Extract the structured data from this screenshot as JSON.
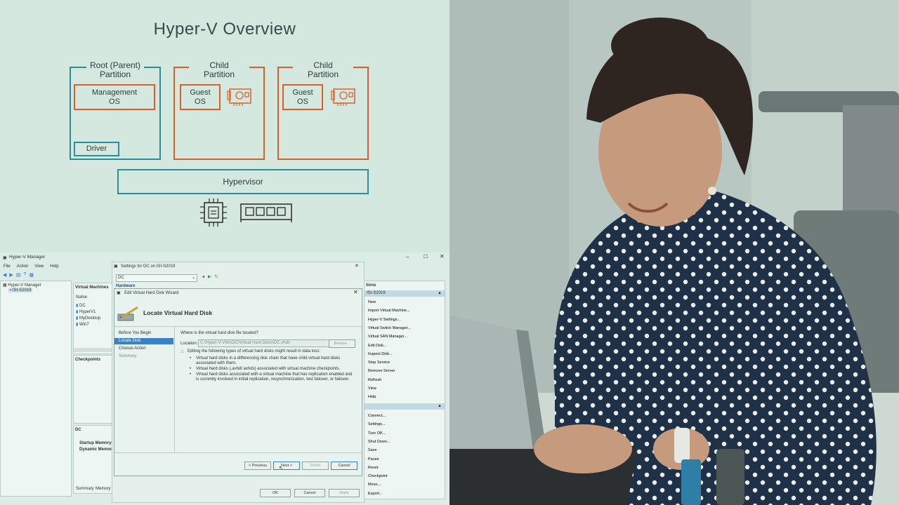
{
  "diagram": {
    "title": "Hyper-V Overview",
    "root_partition": {
      "line1": "Root (Parent)",
      "line2": "Partition",
      "mgmt_line1": "Management",
      "mgmt_line2": "OS",
      "driver": "Driver"
    },
    "child1": {
      "line1": "Child",
      "line2": "Partition",
      "guest_line1": "Guest",
      "guest_line2": "OS"
    },
    "child2": {
      "line1": "Child",
      "line2": "Partition",
      "guest_line1": "Guest",
      "guest_line2": "OS"
    },
    "hypervisor": "Hypervisor",
    "icons": [
      "nic-card-icon",
      "cpu-chip-icon",
      "memory-module-icon"
    ]
  },
  "hv_manager": {
    "title": "Hyper-V Manager",
    "menu": [
      "File",
      "Action",
      "View",
      "Help"
    ],
    "tree_root": "Hyper-V Manager",
    "tree_host": "ISI-S2019",
    "vm_header": "Virtual Machines",
    "vm_col_name": "Name",
    "vms": [
      "DC",
      "HyperV1",
      "MyDesktop",
      "Win7"
    ],
    "checkpoints": "Checkpoints",
    "detail_title": "DC",
    "startup_memory": "Startup Memory",
    "dynamic_memory": "Dynamic Memor",
    "detail_tabs": [
      "Summary",
      "Memory"
    ],
    "actions_label": "tions",
    "actions_host": "ISI-S2019",
    "host_actions": [
      "New",
      "Import Virtual Machine...",
      "Hyper-V Settings...",
      "Virtual Switch Manager...",
      "Virtual SAN Manager...",
      "Edit Disk...",
      "Inspect Disk...",
      "Stop Service",
      "Remove Server",
      "Refresh",
      "View",
      "Help"
    ],
    "vm_actions": [
      "Connect...",
      "Settings...",
      "Turn Off...",
      "Shut Down...",
      "Save",
      "Pause",
      "Reset",
      "Checkpoint",
      "Move...",
      "Export..."
    ]
  },
  "settings_window": {
    "title": "Settings for DC on ISI-S2019",
    "vm_select": "DC",
    "hardware": "Hardware",
    "buttons": {
      "ok": "OK",
      "cancel": "Cancel",
      "apply": "Apply"
    }
  },
  "wizard": {
    "title": "Edit Virtual Hard Disk Wizard",
    "heading": "Locate Virtual Hard Disk",
    "steps": [
      "Before You Begin",
      "Locate Disk",
      "Choose Action",
      "Summary"
    ],
    "question": "Where is the virtual hard disk file located?",
    "location_label": "Location:",
    "location_value": "C:\\Hyper-V-VMs\\DC\\Virtual Hard Disks\\DC.vhdx",
    "browse": "Browse...",
    "warning": "Editing the following types of virtual hard disks might result in data loss:",
    "bullets": [
      "Virtual hard disks in a differencing disk chain that have child virtual hard disks associated with them.",
      "Virtual hard disks (.avhd/.avhdx) associated with virtual machine checkpoints.",
      "Virtual hard disks associated with a virtual machine that has replication enabled and is currently involved in initial replication, resynchronization, test failover, or failover."
    ],
    "buttons": {
      "previous": "< Previous",
      "next": "Next >",
      "finish": "Finish",
      "cancel": "Cancel"
    }
  },
  "colors": {
    "teal": "#2a8f9a",
    "orange": "#d5622c",
    "selection": "#3d7fc4"
  }
}
